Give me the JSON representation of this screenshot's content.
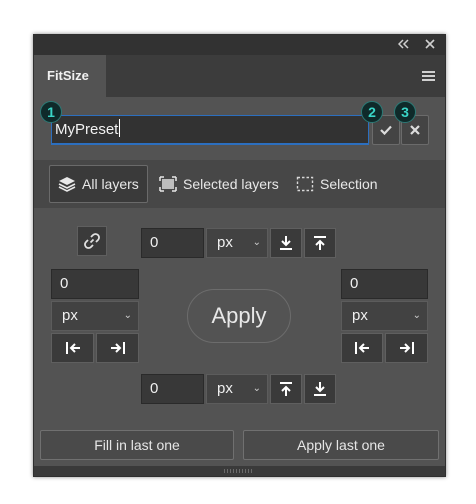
{
  "panel": {
    "collapse_icon": "double-chevron-left-icon",
    "close_icon": "close-icon",
    "tab_title": "FitSize",
    "menu_icon": "hamburger-menu-icon"
  },
  "preset": {
    "value": "MyPreset",
    "confirm_icon": "checkmark-icon",
    "cancel_icon": "x-icon"
  },
  "badges": [
    "1",
    "2",
    "3"
  ],
  "modes": [
    {
      "label": "All layers",
      "icon": "layers-icon",
      "active": true
    },
    {
      "label": "Selected layers",
      "icon": "selected-layers-icon",
      "active": false
    },
    {
      "label": "Selection",
      "icon": "selection-marquee-icon",
      "active": false
    }
  ],
  "top": {
    "value": "0",
    "unit": "px"
  },
  "left": {
    "value": "0",
    "unit": "px"
  },
  "right": {
    "value": "0",
    "unit": "px"
  },
  "bottom": {
    "value": "0",
    "unit": "px"
  },
  "link_icon": "link-icon",
  "apply_label": "Apply",
  "fill_last_label": "Fill in last one",
  "apply_last_label": "Apply last one",
  "colors": {
    "panel_bg": "#535353",
    "focus_border": "#2c6fbf",
    "badge_accent": "#3ad6c8"
  }
}
